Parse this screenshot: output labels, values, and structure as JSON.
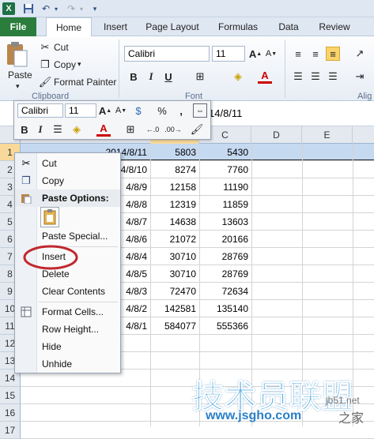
{
  "window": {
    "app_icon": "excel-icon",
    "quick_access": [
      "save-icon",
      "undo-icon",
      "redo-icon"
    ]
  },
  "tabs": [
    "File",
    "Home",
    "Insert",
    "Page Layout",
    "Formulas",
    "Data",
    "Review"
  ],
  "ribbon": {
    "paste_label": "Paste",
    "cut_label": "Cut",
    "copy_label": "Copy",
    "format_painter_label": "Format Painter",
    "clipboard_group": "Clipboard",
    "font_name": "Calibri",
    "font_size": "11",
    "font_group": "Font",
    "align_group": "Alig"
  },
  "formula_bar": {
    "value": "14/8/11"
  },
  "mini_toolbar": {
    "font_name": "Calibri",
    "font_size": "11",
    "percent": "%",
    "comma": ","
  },
  "sheet": {
    "columns": [
      "B",
      "C",
      "D",
      "E"
    ],
    "rows": [
      "1",
      "2",
      "3",
      "4",
      "5",
      "6",
      "7",
      "8",
      "9",
      "10",
      "11",
      "12",
      "13",
      "14",
      "15",
      "16",
      "17"
    ],
    "data": [
      {
        "a": "2014/8/11",
        "b": "5803",
        "c": "5430"
      },
      {
        "a": "4/8/10",
        "b": "8274",
        "c": "7760"
      },
      {
        "a": "4/8/9",
        "b": "12158",
        "c": "11190"
      },
      {
        "a": "4/8/8",
        "b": "12319",
        "c": "11859"
      },
      {
        "a": "4/8/7",
        "b": "14638",
        "c": "13603"
      },
      {
        "a": "4/8/6",
        "b": "21072",
        "c": "20166"
      },
      {
        "a": "4/8/4",
        "b": "30710",
        "c": "28769"
      },
      {
        "a": "4/8/5",
        "b": "30710",
        "c": "28769"
      },
      {
        "a": "4/8/3",
        "b": "72470",
        "c": "72634"
      },
      {
        "a": "4/8/2",
        "b": "142581",
        "c": "135140"
      },
      {
        "a": "4/8/1",
        "b": "584077",
        "c": "555366"
      }
    ]
  },
  "context_menu": {
    "cut": "Cut",
    "copy": "Copy",
    "paste_options": "Paste Options:",
    "paste_special": "Paste Special...",
    "insert": "Insert",
    "delete": "Delete",
    "clear_contents": "Clear Contents",
    "format_cells": "Format Cells...",
    "row_height": "Row Height...",
    "hide": "Hide",
    "unhide": "Unhide"
  },
  "watermark": {
    "text": "技术员联盟",
    "site": "jb51.net",
    "url": "www.jsgho.com",
    "tail": "之家"
  },
  "colors": {
    "file_tab": "#2a7d3c",
    "selection": "#c5d9f1",
    "highlight_circle": "#c0282d"
  }
}
